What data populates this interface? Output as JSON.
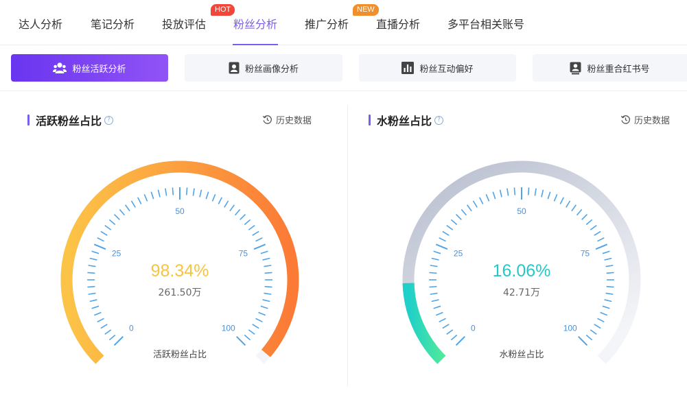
{
  "tabs": [
    {
      "label": "达人分析"
    },
    {
      "label": "笔记分析"
    },
    {
      "label": "投放评估"
    },
    {
      "label": "粉丝分析"
    },
    {
      "label": "推广分析"
    },
    {
      "label": "直播分析"
    },
    {
      "label": "多平台相关账号"
    }
  ],
  "badges": {
    "hot": "HOT",
    "new": "NEW"
  },
  "subtabs": [
    {
      "label": "粉丝活跃分析",
      "icon": "users-icon"
    },
    {
      "label": "粉丝画像分析",
      "icon": "portrait-icon"
    },
    {
      "label": "粉丝互动偏好",
      "icon": "bar-chart-icon"
    },
    {
      "label": "粉丝重合红书号",
      "icon": "badge-icon"
    }
  ],
  "panels": [
    {
      "title": "活跃粉丝占比",
      "history": "历史数据",
      "percent": "98.34%",
      "percent_value": 98.34,
      "count": "261.50万",
      "caption": "活跃粉丝占比",
      "ticks": [
        "0",
        "25",
        "50",
        "75",
        "100"
      ],
      "percent_color": "#f6c443",
      "arc_color_start": "#fcc447",
      "arc_color_end": "#fb7a36"
    },
    {
      "title": "水粉丝占比",
      "history": "历史数据",
      "percent": "16.06%",
      "percent_value": 16.06,
      "count": "42.71万",
      "caption": "水粉丝占比",
      "ticks": [
        "0",
        "25",
        "50",
        "75",
        "100"
      ],
      "percent_color": "#27c7c8",
      "arc_color_start": "#1fcfca",
      "arc_color_end": "#4ee89d"
    }
  ],
  "colors": {
    "accent": "#7b5cf0",
    "tick": "#4fa3e8",
    "tick_label": "#4a90d9",
    "track": "#b5bccd"
  }
}
